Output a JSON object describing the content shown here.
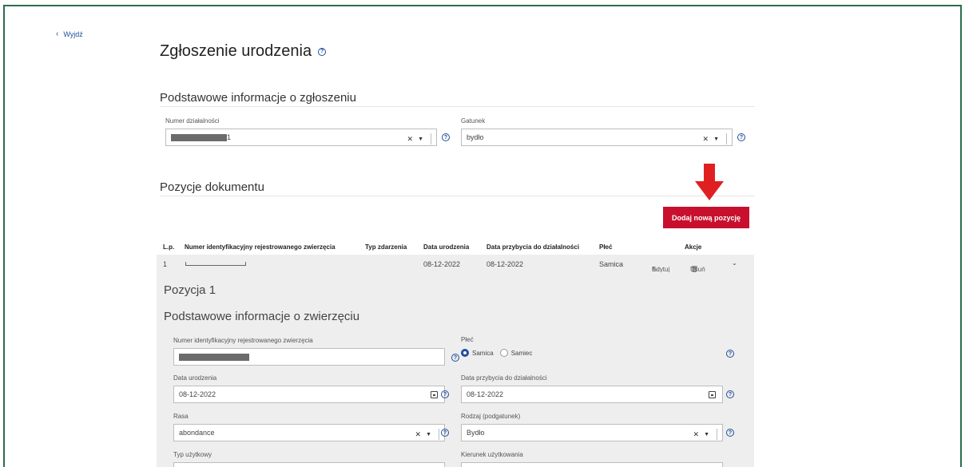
{
  "nav": {
    "back_label": "Wyjdź"
  },
  "page": {
    "title": "Zgłoszenie urodzenia"
  },
  "basic_info": {
    "title": "Podstawowe informacje o zgłoszeniu",
    "activity_number": {
      "label": "Numer działalności",
      "value_suffix": "1"
    },
    "species": {
      "label": "Gatunek",
      "value": "bydło"
    }
  },
  "positions": {
    "title": "Pozycje dokumentu",
    "add_button": "Dodaj nową pozycję",
    "columns": [
      "L.p.",
      "Numer identyfikacyjny rejestrowanego zwierzęcia",
      "Typ zdarzenia",
      "Data urodzenia",
      "Data przybycia do działalności",
      "Płeć",
      "Akcje"
    ],
    "rows": [
      {
        "lp": "1",
        "event_type": "",
        "birth_date": "08-12-2022",
        "arrival_date": "08-12-2022",
        "sex": "Samica",
        "edit_label": "Edytuj",
        "delete_label": "Usuń"
      }
    ]
  },
  "detail": {
    "title": "Pozycja 1",
    "subtitle": "Podstawowe informacje o zwierzęciu",
    "id_label": "Numer identyfikacyjny rejestrowanego zwierzęcia",
    "sex_label": "Płeć",
    "sex_options": [
      "Samica",
      "Samiec"
    ],
    "sex_selected": "Samica",
    "birth_date_label": "Data urodzenia",
    "birth_date_value": "08-12-2022",
    "arrival_label": "Data przybycia do działalności",
    "arrival_value": "08-12-2022",
    "breed_label": "Rasa",
    "breed_value": "abondance",
    "kind_label": "Rodzaj (podgatunek)",
    "kind_value": "Bydło",
    "usage_type_label": "Typ użytkowy",
    "usage_direction_label": "Kierunek użytkowania"
  },
  "colors": {
    "accent": "#c8102e",
    "link": "#1f4e9c",
    "frame": "#2d6e4a"
  }
}
